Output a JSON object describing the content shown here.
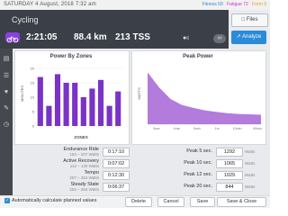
{
  "topbar": {
    "date": "SATURDAY  4 August, 2018  7:32 am",
    "fitness": "Fitness 59",
    "fatigue": "Fatigue 72",
    "form": "Form 9",
    "colors": {
      "fitness": "#2a8bd8",
      "fatigue": "#c23cc2",
      "form": "#e3a11a"
    }
  },
  "workout": {
    "title": "Cycling",
    "duration": "2:21:05",
    "distance": "88.4 km",
    "tss": "213 TSS",
    "icon": "bike-icon",
    "pin_icon": "pin-icon",
    "pin_count": "6",
    "link_icon": "link-icon"
  },
  "actions": {
    "files": "Files",
    "analyze": "Analyze"
  },
  "sidebar": {
    "icons": [
      "document-icon",
      "list-icon",
      "heart-icon",
      "pencil-icon",
      "clock-icon"
    ]
  },
  "charts": {
    "zones": {
      "title": "Power By Zones",
      "ylabel": "MINUTES",
      "xlabel": "ZONES",
      "yticks": [
        "20",
        "15",
        "10",
        "5",
        "0"
      ],
      "color": "#7a32c7"
    },
    "peak": {
      "title": "Peak Power",
      "ylabel": "WATTS",
      "xticks": [
        "5sec",
        "1min",
        "5min",
        "1hr",
        "10min",
        "50min"
      ],
      "color": "#9a4fd0"
    }
  },
  "chart_data": [
    {
      "type": "bar",
      "title": "Power By Zones",
      "xlabel": "ZONES",
      "ylabel": "MINUTES",
      "ylim": [
        0,
        20
      ],
      "categories": [
        "1",
        "2",
        "3",
        "4",
        "5",
        "6",
        "7",
        "8",
        "9",
        "10"
      ],
      "values": [
        17,
        7,
        18,
        15,
        15,
        10,
        13,
        16,
        7,
        12
      ]
    },
    {
      "type": "area",
      "title": "Peak Power",
      "ylabel": "WATTS",
      "ylim": [
        0,
        1400
      ],
      "x": [
        0,
        1,
        2,
        3,
        4,
        5,
        6,
        7,
        8,
        9,
        10
      ],
      "values": [
        1260,
        900,
        620,
        470,
        400,
        340,
        300,
        270,
        250,
        240,
        230
      ],
      "xticks": [
        "5sec",
        "1min",
        "5min",
        "1hr",
        "10min",
        "50min"
      ]
    }
  ],
  "zones_form": [
    {
      "label": "Endurance Ride",
      "sub": "154 – 207 Watts",
      "value": "0:17:10"
    },
    {
      "label": "Active Recovery",
      "sub": "112 – 140 Watts",
      "value": "0:07:02"
    },
    {
      "label": "Tempo",
      "sub": "207 – 252 Watts",
      "value": "0:12:30"
    },
    {
      "label": "Steady State",
      "sub": "252 – 264 Watts",
      "value": "0:06:37"
    }
  ],
  "peak_form": [
    {
      "label": "Peak 5 sec.",
      "value": "1292",
      "unit": "Watts"
    },
    {
      "label": "Peak 10 sec.",
      "value": "1065",
      "unit": "Watts"
    },
    {
      "label": "Peak 12 sec.",
      "value": "1029",
      "unit": "Watts"
    },
    {
      "label": "Peak 20 sec.",
      "value": "844",
      "unit": "Watts"
    }
  ],
  "footer": {
    "auto_calc": "Automatically calculate planned values",
    "delete": "Delete",
    "cancel": "Cancel",
    "save": "Save",
    "save_close": "Save & Close"
  }
}
